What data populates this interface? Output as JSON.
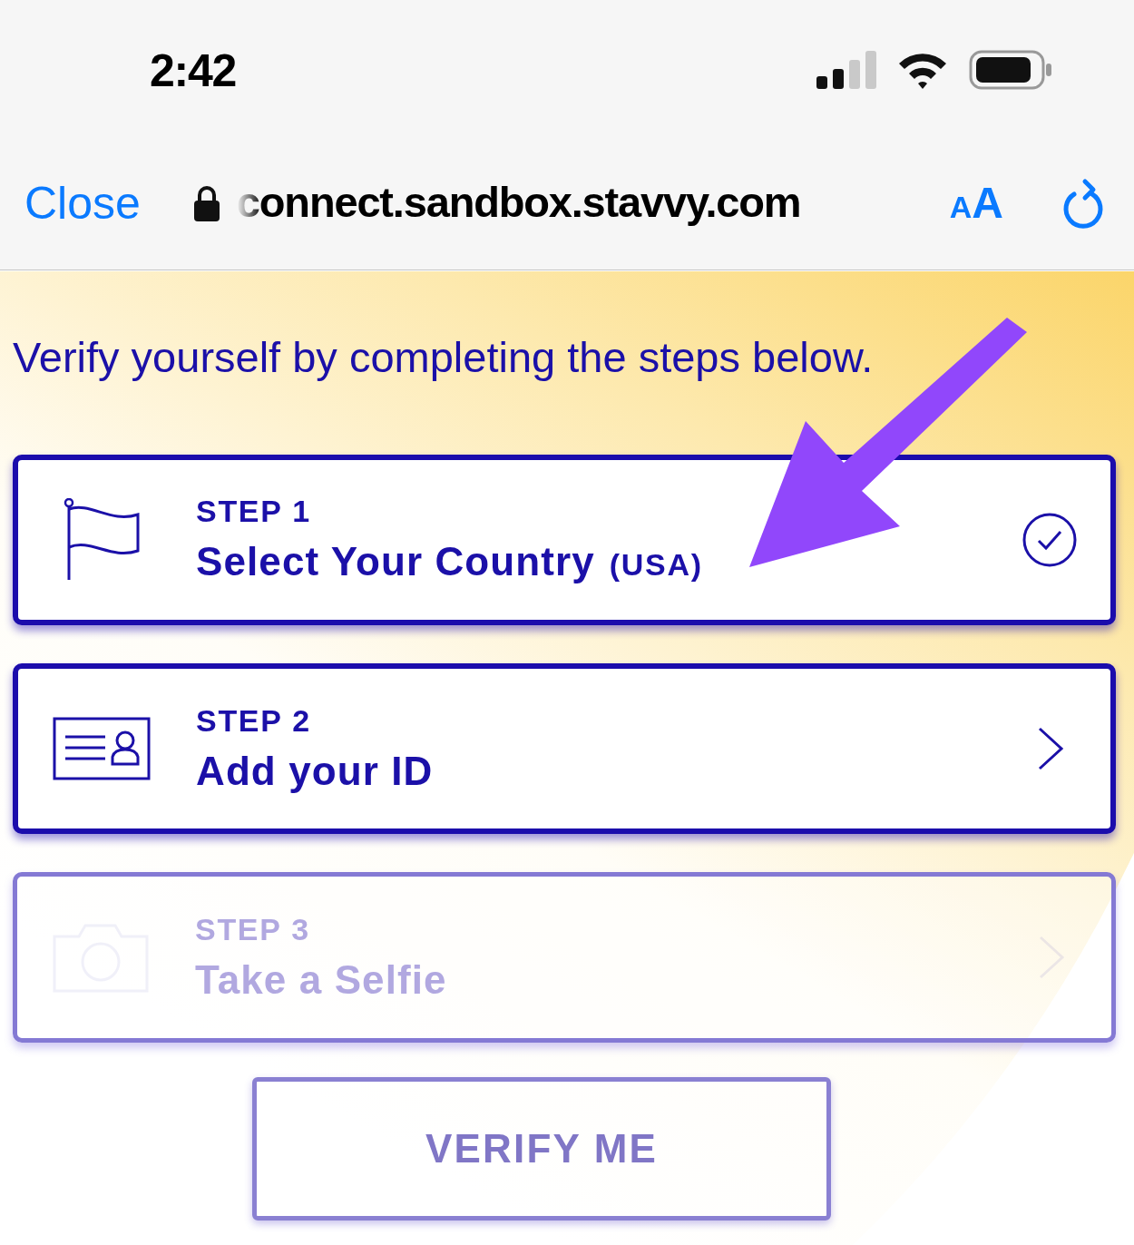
{
  "status_bar": {
    "time": "2:42"
  },
  "browser_bar": {
    "close": "Close",
    "url": "connect.sandbox.stavvy.com",
    "text_size": "AA"
  },
  "intro": "Verify yourself by completing the steps below.",
  "steps": [
    {
      "kind": "flag",
      "step": "STEP 1",
      "title": "Select Your Country",
      "detail": "(USA)",
      "completed": true,
      "disabled": false
    },
    {
      "kind": "id-card",
      "step": "STEP 2",
      "title": "Add your ID",
      "completed": false,
      "disabled": false
    },
    {
      "kind": "camera",
      "step": "STEP 3",
      "title": "Take a Selfie",
      "completed": false,
      "disabled": true
    }
  ],
  "verify_button": {
    "label": "VERIFY ME",
    "disabled": true
  }
}
